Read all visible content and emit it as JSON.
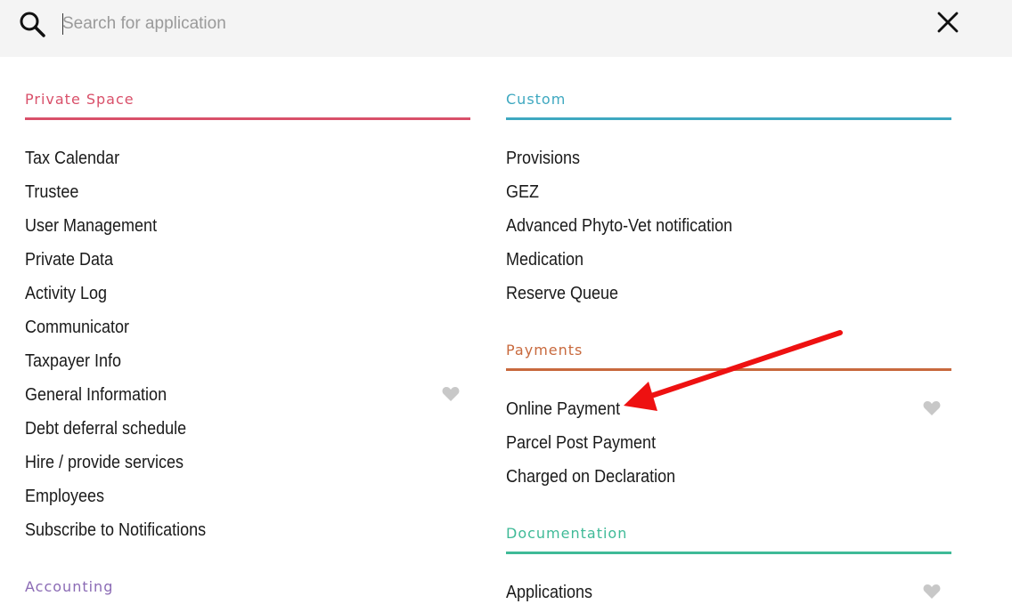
{
  "search": {
    "placeholder": "Search for application"
  },
  "colors": {
    "private": "#d9506a",
    "custom": "#3ea8c0",
    "payments": "#c8693d",
    "documentation": "#3fba97",
    "accounting": "#8b6bb5",
    "heart": "#c8c8c8",
    "arrow": "#ee1111"
  },
  "sections": {
    "private_space": {
      "title": "Private Space",
      "items": [
        "Tax Calendar",
        "Trustee",
        "User Management",
        "Private Data",
        "Activity Log",
        "Communicator",
        "Taxpayer Info",
        "General Information",
        "Debt deferral schedule",
        "Hire / provide services",
        "Employees",
        "Subscribe to Notifications"
      ]
    },
    "accounting": {
      "title": "Accounting"
    },
    "custom": {
      "title": "Custom",
      "items": [
        "Provisions",
        "GEZ",
        "Advanced Phyto-Vet notification",
        "Medication",
        "Reserve Queue"
      ]
    },
    "payments": {
      "title": "Payments",
      "items": [
        "Online Payment",
        "Parcel Post Payment",
        "Charged on Declaration"
      ]
    },
    "documentation": {
      "title": "Documentation",
      "items": [
        "Applications"
      ]
    }
  },
  "icons": [
    "search-icon",
    "close-icon",
    "heart-icon",
    "arrow-annotation"
  ]
}
